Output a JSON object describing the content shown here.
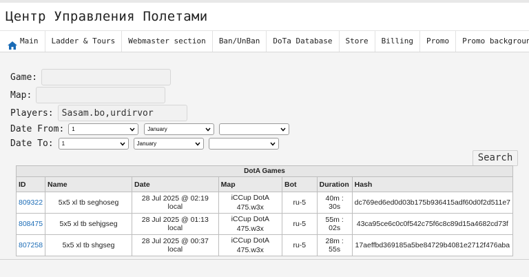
{
  "app": {
    "title": "Центр Управления Полетами"
  },
  "nav": {
    "items": [
      {
        "label": "Main",
        "icon": "home-icon"
      },
      {
        "label": "Ladder & Tours"
      },
      {
        "label": "Webmaster section"
      },
      {
        "label": "Ban/UnBan"
      },
      {
        "label": "DoTa Database"
      },
      {
        "label": "Store"
      },
      {
        "label": "Billing"
      },
      {
        "label": "Promo"
      },
      {
        "label": "Promo background"
      }
    ]
  },
  "form": {
    "game_label": "Game:",
    "game_value": "",
    "map_label": "Map:",
    "map_value": "",
    "players_label": "Players:",
    "players_value": "Sasam.bo,urdirvor",
    "date_from_label": "Date From:",
    "date_from": {
      "day": "1",
      "month": "January",
      "year": ""
    },
    "date_to_label": "Date To:",
    "date_to": {
      "day": "1",
      "month": "January",
      "year": ""
    },
    "search_label": "Search"
  },
  "table": {
    "caption": "DotA Games",
    "headers": [
      "ID",
      "Name",
      "Date",
      "Map",
      "Bot",
      "Duration",
      "Hash"
    ],
    "rows": [
      {
        "id": "809322",
        "name": "5x5 xl tb seghoseg",
        "date": "28 Jul 2025 @ 02:19 local",
        "map_line1": "iCCup DotA",
        "map_line2": "475.w3x",
        "bot": "ru-5",
        "duration": "40m : 30s",
        "hash": "dc769ed6ed0d03b175b936415adf60d0f2d511e7"
      },
      {
        "id": "808475",
        "name": "5x5 xl tb sehjgseg",
        "date": "28 Jul 2025 @ 01:13 local",
        "map_line1": "iCCup DotA",
        "map_line2": "475.w3x",
        "bot": "ru-5",
        "duration": "55m : 02s",
        "hash": "43ca95ce6c0c0f542c75f6c8c89d15a4682cd73f"
      },
      {
        "id": "807258",
        "name": "5x5 xl tb shgseg",
        "date": "28 Jul 2025 @ 00:37 local",
        "map_line1": "iCCup DotA",
        "map_line2": "475.w3x",
        "bot": "ru-5",
        "duration": "28m : 55s",
        "hash": "17aeffbd369185a5be84729b4081e2712f476aba"
      }
    ]
  },
  "colors": {
    "link": "#1a6bb6",
    "home_icon": "#1a6bb6"
  }
}
